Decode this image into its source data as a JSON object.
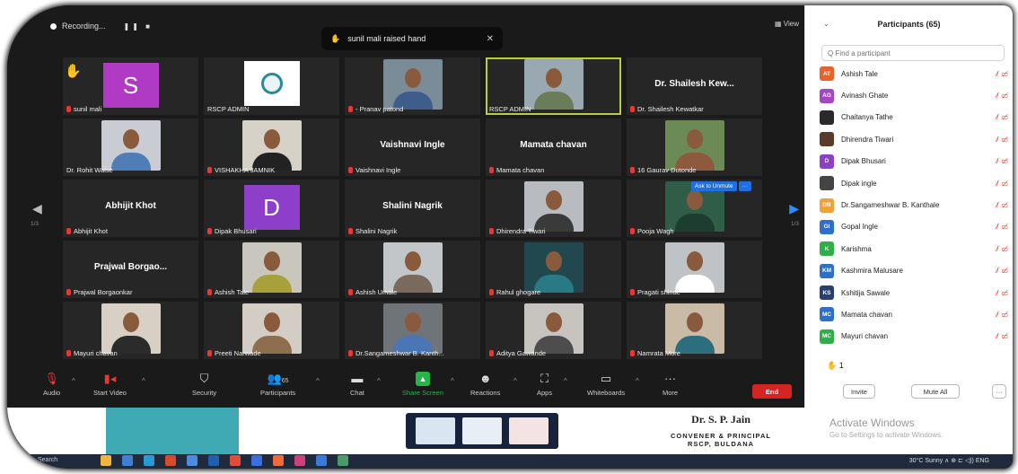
{
  "recording": {
    "label": "Recording...",
    "controls": "❚❚ ■"
  },
  "notification": {
    "icon": "✋",
    "text": "sunil mali raised hand",
    "close": "✕"
  },
  "view_label": "▦ View",
  "raised_hand_icon": "✋",
  "nav": {
    "left_arrow": "◀",
    "right_arrow": "▶",
    "page_left": "1/3",
    "page_right": "1/3"
  },
  "tiles": [
    {
      "kind": "avatar",
      "letter": "S",
      "color": "#b13ac4",
      "caption": "sunil mali",
      "mic": true
    },
    {
      "kind": "logo",
      "caption": "RSCP ADMIN",
      "mic": false
    },
    {
      "kind": "photo",
      "bg": "#7b8c99",
      "shirt": "#3e5d8a",
      "caption": "- Pranav patond",
      "mic": true
    },
    {
      "kind": "photo",
      "bg": "#9aa8b2",
      "shirt": "#6b7c5a",
      "caption": "RSCP ADMIN",
      "mic": false,
      "active": true
    },
    {
      "kind": "name",
      "name": "Dr. Shailesh Kew...",
      "caption": "Dr. Shailesh Kewatkar",
      "mic": true
    },
    {
      "kind": "photo",
      "bg": "#c9cdd3",
      "shirt": "#4f7db7",
      "caption": "Dr. Rohit Walse",
      "mic": false
    },
    {
      "kind": "photo",
      "bg": "#d6d2c8",
      "shirt": "#222222",
      "caption": "VISHAKHA JAMNIK",
      "mic": true
    },
    {
      "kind": "name",
      "name": "Vaishnavi Ingle",
      "caption": "Vaishnavi Ingle",
      "mic": true
    },
    {
      "kind": "name",
      "name": "Mamata chavan",
      "caption": "Mamata chavan",
      "mic": true
    },
    {
      "kind": "photo",
      "bg": "#6c8a55",
      "shirt": "#8e5a3d",
      "caption": "16 Gaurav Dutonde",
      "mic": true
    },
    {
      "kind": "name",
      "name": "Abhijit Khot",
      "caption": "Abhijit Khot",
      "mic": true
    },
    {
      "kind": "avatar",
      "letter": "D",
      "color": "#8e3fc9",
      "caption": "Dipak Bhusari",
      "mic": true
    },
    {
      "kind": "name",
      "name": "Shalini Nagrik",
      "caption": "Shalini Nagrik",
      "mic": true
    },
    {
      "kind": "photo",
      "bg": "#b8bcc0",
      "shirt": "#3a3a3a",
      "caption": "Dhirendra Tiwari",
      "mic": true
    },
    {
      "kind": "photo",
      "bg": "#2f5d47",
      "shirt": "#1d3d30",
      "caption": "Pooja Wagh",
      "mic": true,
      "ask": true
    },
    {
      "kind": "name",
      "name": "Prajwal Borgao...",
      "caption": "Prajwal Borgaonkar",
      "mic": true
    },
    {
      "kind": "photo",
      "bg": "#c9c6bd",
      "shirt": "#a8a03b",
      "caption": "Ashish Tale",
      "mic": true
    },
    {
      "kind": "photo",
      "bg": "#c2c6c9",
      "shirt": "#7a6a5d",
      "caption": "Ashish Umale",
      "mic": true
    },
    {
      "kind": "photo",
      "bg": "#22484f",
      "shirt": "#2a7a86",
      "caption": "Rahul ghogare",
      "mic": true
    },
    {
      "kind": "photo",
      "bg": "#bfc3c6",
      "shirt": "#ffffff",
      "caption": "Pragati shinde",
      "mic": true
    },
    {
      "kind": "photo",
      "bg": "#d8d0c4",
      "shirt": "#2b2b2b",
      "caption": "Mayuri chavan",
      "mic": true
    },
    {
      "kind": "photo",
      "bg": "#d3cdc6",
      "shirt": "#8d6e4e",
      "caption": "Preeti Narwade",
      "mic": true
    },
    {
      "kind": "photo",
      "bg": "#6f7478",
      "shirt": "#4a76b5",
      "caption": "Dr.Sangameshwar B. Kanth...",
      "mic": true
    },
    {
      "kind": "photo",
      "bg": "#c7c4bf",
      "shirt": "#4d4d4d",
      "caption": "Aditya Gawande",
      "mic": true
    },
    {
      "kind": "photo",
      "bg": "#c9bba6",
      "shirt": "#2c6e7d",
      "caption": "Namrata More",
      "mic": true
    }
  ],
  "ask_to_unmute": "Ask to Unmute",
  "more_dots": "···",
  "toolbar": {
    "audio": "Audio",
    "video": "Start Video",
    "security": "Security",
    "participants": "Participants",
    "participants_count": "65",
    "chat": "Chat",
    "share": "Share Screen",
    "reactions": "Reactions",
    "apps": "Apps",
    "whiteboards": "Whiteboards",
    "more": "More",
    "end": "End"
  },
  "panel": {
    "chevron": "⌄",
    "title": "Participants (65)",
    "search_placeholder": "Q Find a participant",
    "participants": [
      {
        "initials": "AT",
        "name": "Ashish Tale",
        "color": "#e8622c"
      },
      {
        "initials": "AG",
        "name": "Avinash Ghate",
        "color": "#a347c6"
      },
      {
        "initials": "",
        "name": "Chaitanya Tathe",
        "color": "#2a2a2a"
      },
      {
        "initials": "",
        "name": "Dhirendra Tiwari",
        "color": "#5a3a2a"
      },
      {
        "initials": "D",
        "name": "Dipak Bhusari",
        "color": "#8e3fc9"
      },
      {
        "initials": "",
        "name": "Dipak ingle",
        "color": "#444444"
      },
      {
        "initials": "DB",
        "name": "Dr.Sangameshwar B. Kanthale",
        "color": "#f0a23a"
      },
      {
        "initials": "GI",
        "name": "Gopal Ingle",
        "color": "#2d6fc9"
      },
      {
        "initials": "K",
        "name": "Karishma",
        "color": "#2fae4a"
      },
      {
        "initials": "KM",
        "name": "Kashmira Malusare",
        "color": "#2d6fc9"
      },
      {
        "initials": "KS",
        "name": "Kshitija Sawale",
        "color": "#2a3f6e"
      },
      {
        "initials": "MC",
        "name": "Mamata chavan",
        "color": "#2d6fc9"
      },
      {
        "initials": "MC",
        "name": "Mayuri chavan",
        "color": "#2fae4a"
      }
    ],
    "raised_hand": "✋",
    "raised_count": "1",
    "invite": "Invite",
    "mute_all": "Mute All",
    "more": "···"
  },
  "banner": {
    "name": "Dr. S. P. Jain",
    "role": "CONVENER & PRINCIPAL",
    "org": "RSCP, BULDANA",
    "activate_title": "Activate Windows",
    "activate_sub": "Go to Settings to activate Windows."
  },
  "taskbar": {
    "search": "Search",
    "tray": "30°C Sunny ∧ ⊕ ⊏ ◁)) ENG",
    "apps": [
      "#f3b33c",
      "#3f7fd6",
      "#2a9ad6",
      "#d94a2c",
      "#4c8be0",
      "#1f5fb0",
      "#e34b3b",
      "#3b6fe0",
      "#f06a3a",
      "#cf3f7a",
      "#3a7ad6",
      "#4a9a6a"
    ]
  }
}
